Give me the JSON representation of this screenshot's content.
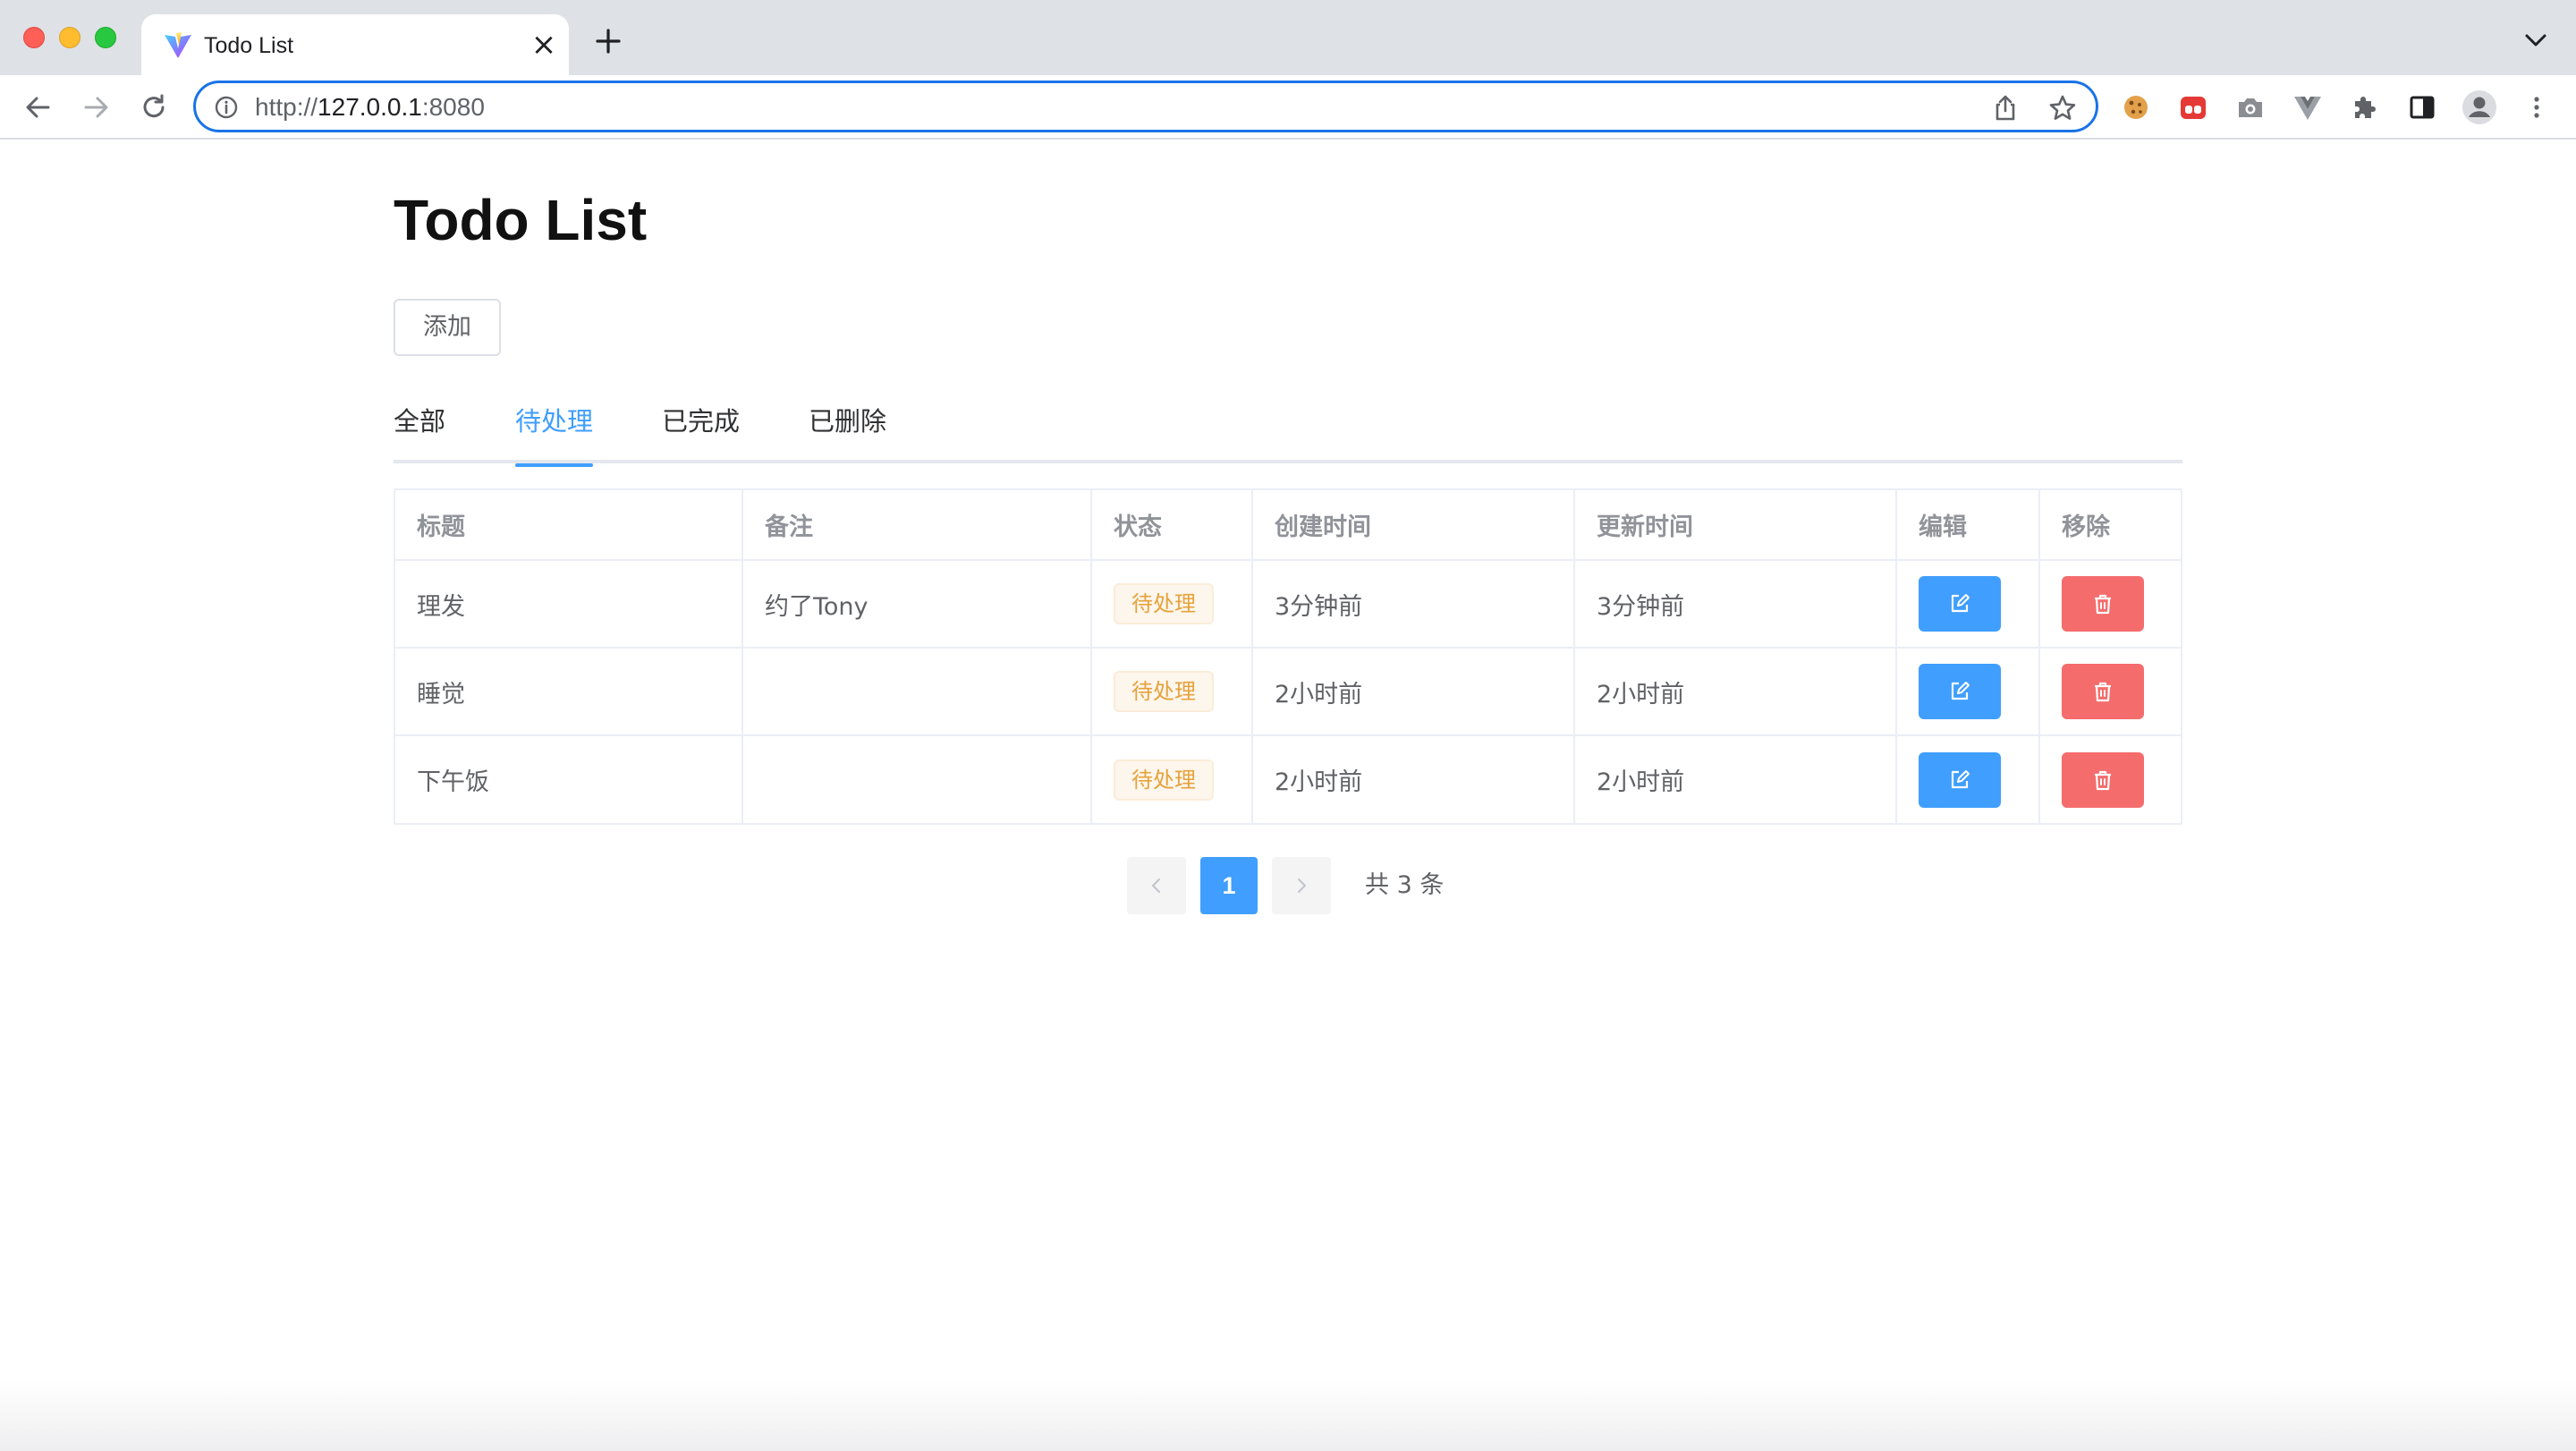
{
  "browser": {
    "tab_title": "Todo List",
    "tab_close": "×",
    "url_scheme": "http://",
    "url_host": "127.0.0.1",
    "url_port": ":8080",
    "icons": [
      "vite-favicon-icon",
      "back-icon",
      "forward-icon",
      "reload-icon",
      "info-icon",
      "share-icon",
      "star-icon",
      "cookie-extension-icon",
      "red-extension-icon",
      "camera-extension-icon",
      "vue-devtools-icon",
      "puzzle-extension-icon",
      "side-panel-icon",
      "profile-icon",
      "more-icon"
    ]
  },
  "page": {
    "title": "Todo List",
    "add_label": "添加",
    "tabs": [
      {
        "label": "全部"
      },
      {
        "label": "待处理"
      },
      {
        "label": "已完成"
      },
      {
        "label": "已删除"
      }
    ],
    "active_tab": "待处理",
    "table": {
      "headers": [
        "标题",
        "备注",
        "状态",
        "创建时间",
        "更新时间",
        "编辑",
        "移除"
      ],
      "rows": [
        {
          "title": "理发",
          "note": "约了Tony",
          "status": "待处理",
          "created": "3分钟前",
          "updated": "3分钟前"
        },
        {
          "title": "睡觉",
          "note": "",
          "status": "待处理",
          "created": "2小时前",
          "updated": "2小时前"
        },
        {
          "title": "下午饭",
          "note": "",
          "status": "待处理",
          "created": "2小时前",
          "updated": "2小时前"
        }
      ]
    },
    "pagination": {
      "current_page": "1",
      "total_text": "共 3 条"
    }
  },
  "colors": {
    "primary": "#409eff",
    "danger": "#f56c6c",
    "warning_text": "#e6a23c",
    "warning_bg": "#fdf6ec"
  }
}
